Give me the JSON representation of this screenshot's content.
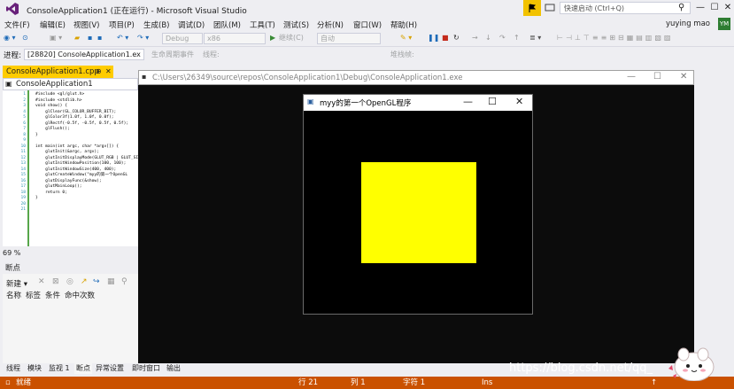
{
  "app_title": "ConsoleApplication1 (正在运行) - Microsoft Visual Studio",
  "quick_launch_placeholder": "快速启动 (Ctrl+Q)",
  "user": {
    "name": "yuying mao",
    "initials": "YM"
  },
  "menu": [
    "文件(F)",
    "编辑(E)",
    "视图(V)",
    "项目(P)",
    "生成(B)",
    "调试(D)",
    "团队(M)",
    "工具(T)",
    "测试(S)",
    "分析(N)",
    "窗口(W)",
    "帮助(H)"
  ],
  "toolbar": {
    "config": "Debug",
    "platform": "x86",
    "continue": "继续(C)",
    "launch": "自动"
  },
  "process": {
    "label": "进程:",
    "value": "[28820] ConsoleApplication1.ex",
    "lifecycle": "生命周期事件",
    "thread": "线程:",
    "stack": "堆栈帧:"
  },
  "editor": {
    "tab": "ConsoleApplication1.cpp",
    "nav": "ConsoleApplication1",
    "zoom": "69 %",
    "line_numbers": [
      "1",
      "2",
      "3",
      "4",
      "5",
      "6",
      "7",
      "8",
      "9",
      "10",
      "11",
      "12",
      "13",
      "14",
      "15",
      "16",
      "17",
      "18",
      "19",
      "20",
      "21"
    ],
    "code": "#include <gl/glut.h>\n#include <stdlib.h>\nvoid show() {\n    glClear(GL_COLOR_BUFFER_BIT);\n    glColor3f(1.0f, 1.0f, 0.0f);\n    glRectf(-0.5f, -0.5f, 0.5f, 0.5f);\n    glFlush();\n}\n\nint main(int argc, char *argv[]) {\n    glutInit(&argc, argv);\n    glutInitDisplayMode(GLUT_RGB | GLUT_SINGLE);\n    glutInitWindowPosition(100, 100);\n    glutInitWindowSize(400, 400);\n    glutCreateWindow(\"myy的第一个OpenGL\n    glutDisplayFunc(&show);\n    glutMainLoop();\n    return 0;\n}\n"
  },
  "console": {
    "path": "C:\\Users\\26349\\source\\repos\\ConsoleApplication1\\Debug\\ConsoleApplication1.exe"
  },
  "gl_window": {
    "title": "myy的第一个OpenGL程序",
    "fill_color": "#FFFF00"
  },
  "breakpoints": {
    "title": "断点",
    "new_label": "新建",
    "columns": [
      "名称",
      "标签",
      "条件",
      "命中次数"
    ]
  },
  "bottom_tabs": [
    "线程",
    "模块",
    "监视 1",
    "断点",
    "异常设置",
    "即时窗口",
    "输出"
  ],
  "status": {
    "state": "就绪",
    "line": "行 21",
    "col": "列 1",
    "char": "字符 1",
    "mode": "Ins"
  },
  "watermark": "https://blog.csdn.net/qq_",
  "colors": {
    "accent": "#CA5100",
    "tab_active": "#FFCC00",
    "vs_purple": "#68217A"
  }
}
